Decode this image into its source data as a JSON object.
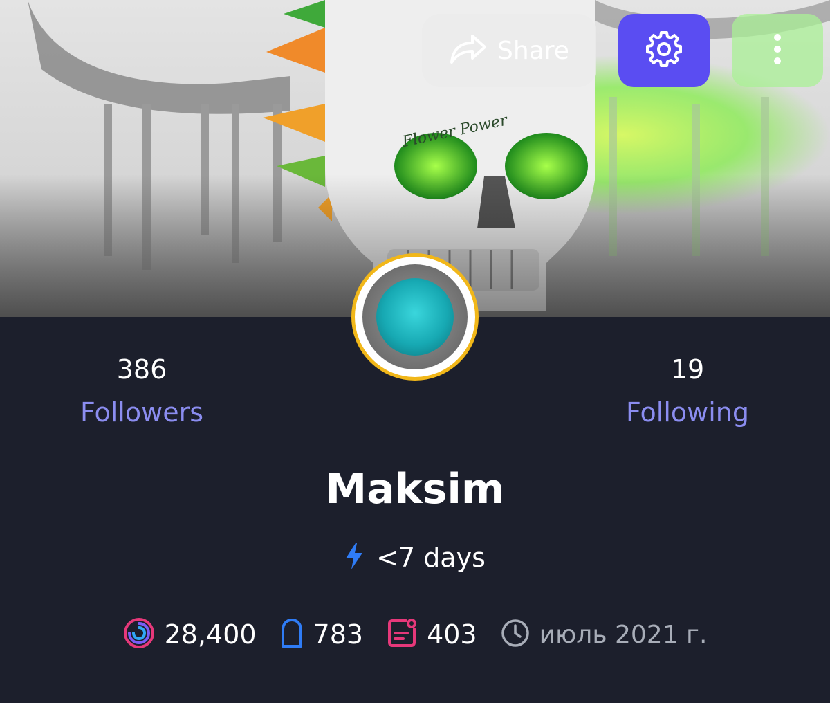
{
  "header": {
    "share_label": "Share",
    "settings_icon": "gear-icon",
    "more_icon": "more-vertical-icon",
    "share_icon": "share-arrow-icon",
    "accent_color": "#5a4df2"
  },
  "cover": {
    "artwork_text": "Flower Power"
  },
  "profile": {
    "name": "Maksim",
    "avatar_border_color": "#f1b719",
    "activity": "<7 days",
    "activity_icon": "lightning-icon"
  },
  "followers": {
    "count": "386",
    "label": "Followers"
  },
  "following": {
    "count": "19",
    "label": "Following"
  },
  "stats": {
    "coins": {
      "value": "28,400",
      "icon": "spiral-coin-icon"
    },
    "tombstones": {
      "value": "783",
      "icon": "arch-icon"
    },
    "posts": {
      "value": "403",
      "icon": "notification-card-icon"
    },
    "joined": {
      "value": "июль 2021 г.",
      "icon": "clock-icon"
    }
  }
}
